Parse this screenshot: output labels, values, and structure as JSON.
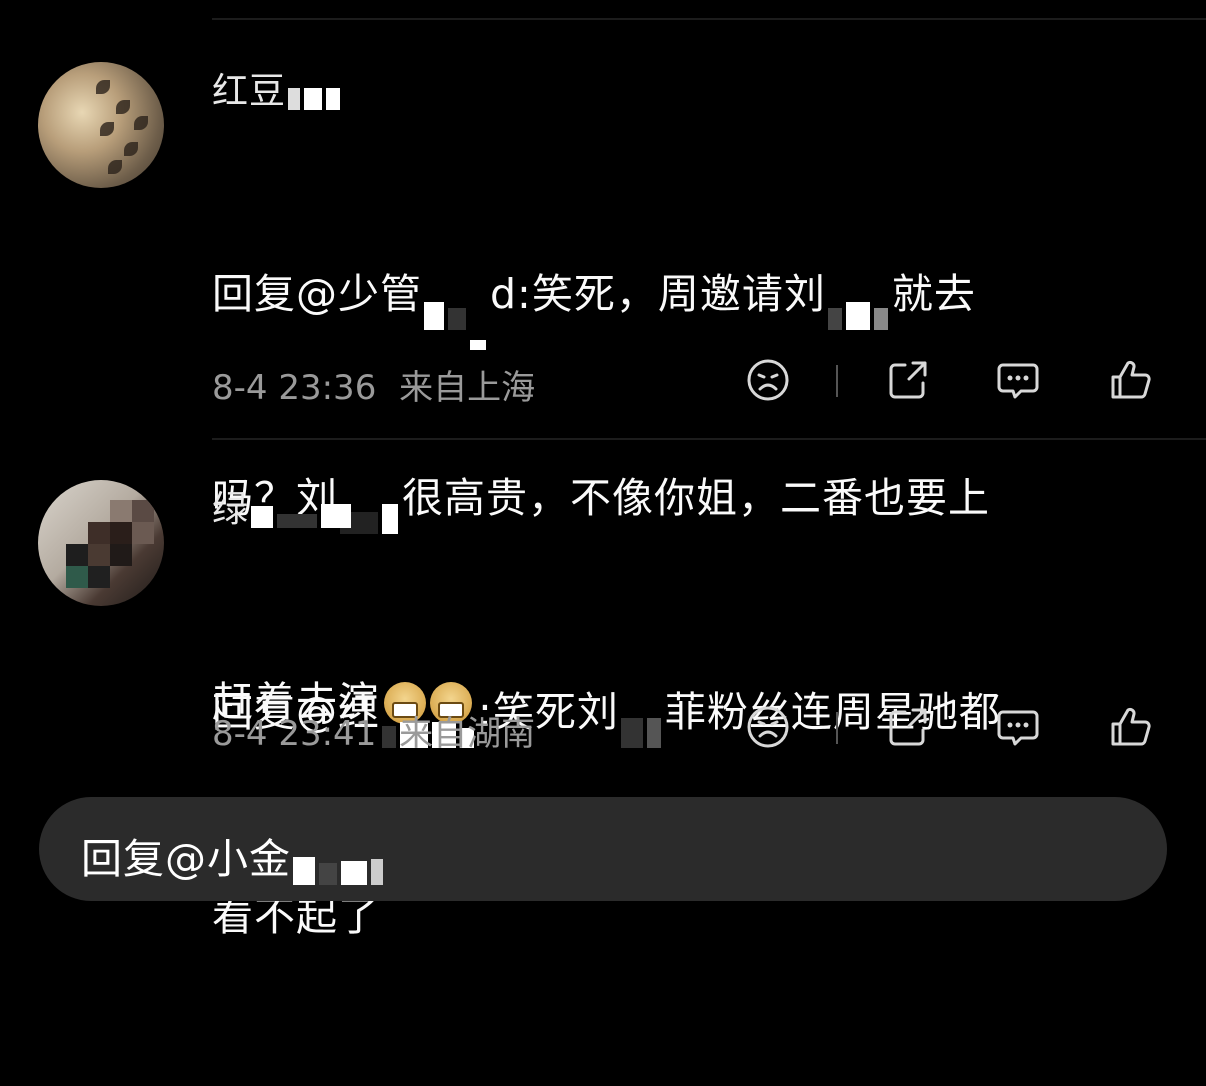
{
  "comments": [
    {
      "username": "红豆",
      "content_line1": "回复@少管",
      "content_line1b": "d:笑死，周邀请刘",
      "content_line1c": "就去",
      "content_line2": "吗？刘",
      "content_line2b": "很高贵，不像你姐，二番也要上",
      "content_line3": "赶着去演",
      "timestamp": "8-4 23:36",
      "location": "来自上海",
      "actions": [
        "dislike-icon",
        "share-icon",
        "comment-icon",
        "like-icon"
      ]
    },
    {
      "username": "绿",
      "content_line1": "回复@红",
      "content_line1b": ":笑死刘",
      "content_line1c": "菲粉丝连周星驰都",
      "content_line2": "看不起了",
      "timestamp": "8-4 23:41",
      "location": "来自湖南",
      "actions": [
        "dislike-icon",
        "share-icon",
        "comment-icon",
        "like-icon"
      ]
    }
  ],
  "reply_bar": {
    "placeholder": "回复@小金"
  }
}
